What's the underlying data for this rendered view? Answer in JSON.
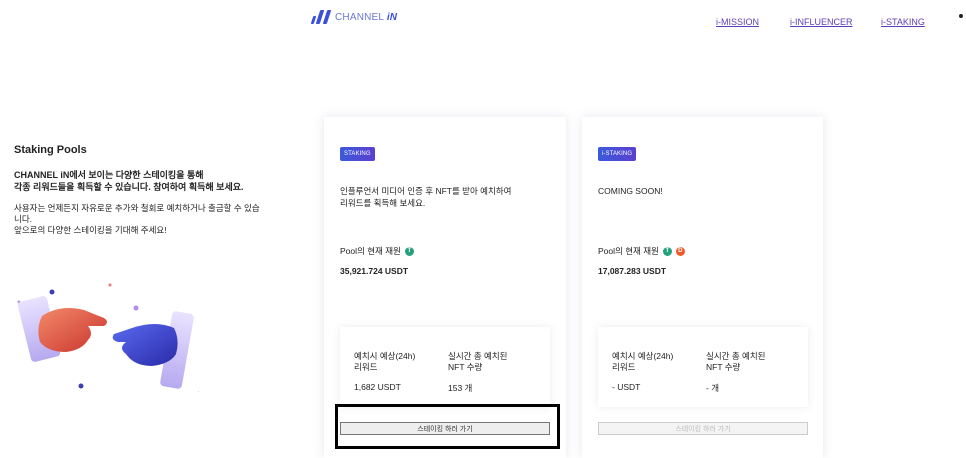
{
  "header": {
    "logo_text": "CHANNEL",
    "logo_suffix": "iN",
    "nav": [
      "i-MISSION",
      "i-INFLUENCER",
      "i-STAKING"
    ]
  },
  "intro": {
    "title": "Staking Pools",
    "lead": "CHANNEL iN에서 보이는 다양한 스테이킹을 통해\n 각종 리워드들을 획득할 수 있습니다. 참여하여 획득해 보세요.",
    "desc": "사용자는 언제든지 자유로운 추가와 철회로 예치하거나 출금할 수 있습\n니다.\n앞으로의 다양한 스테이킹을 기대해 주세요!"
  },
  "cards": [
    {
      "badge": "STAKING",
      "description": "인플루언서 미디어 인증 후 NFT를 받아 예치하여\n리워드를 획득해 보세요.",
      "pool_label": "Pool의 현재 재원",
      "pool_value": "35,921.724 USDT",
      "stat1_label": "예치시 예상(24h)\n리워드",
      "stat1_value": "1,682 USDT",
      "stat2_label": "실시간 총 예치된\nNFT 수량",
      "stat2_value": "153 개",
      "button": "스테이킹 하러 가기"
    },
    {
      "badge": "i-STAKING",
      "description": "COMING SOON!",
      "pool_label": "Pool의 현재 재원",
      "pool_value": "17,087.283 USDT",
      "stat1_label": "예치시 예상(24h)\n리워드",
      "stat1_value": "- USDT",
      "stat2_label": "실시간 총 예치된\nNFT 수량",
      "stat2_value": "- 개",
      "button": "스테이킹 하러 가기"
    }
  ],
  "colors": {
    "accent": "#3b4fd8",
    "link": "#5a3fb8",
    "tether": "#26a17b"
  }
}
